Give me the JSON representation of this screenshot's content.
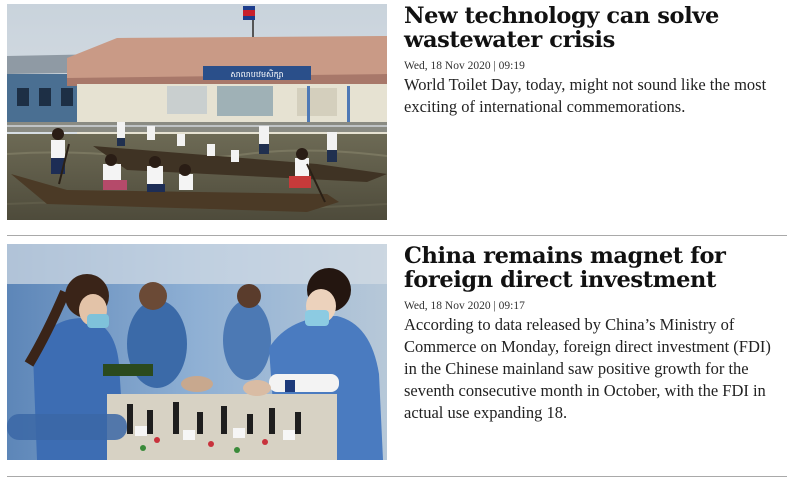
{
  "articles": [
    {
      "headline": "New technology can solve wastewater crisis",
      "date": "Wed, 18 Nov 2020",
      "separator": "|",
      "time": "09:19",
      "summary": "World Toilet Day, today, might not sound like the most exciting of international commemorations.",
      "image_sign": "សាលាបឋមសិក្សា"
    },
    {
      "headline": "China remains magnet for foreign direct investment",
      "date": "Wed, 18 Nov 2020",
      "separator": "|",
      "time": "09:17",
      "summary": "According to data released by China’s Ministry of Commerce on Monday, foreign direct investment (FDI) in the Chinese mainland saw positive growth for the seventh consecutive month in October, with the FDI in actual use expanding 18."
    }
  ]
}
